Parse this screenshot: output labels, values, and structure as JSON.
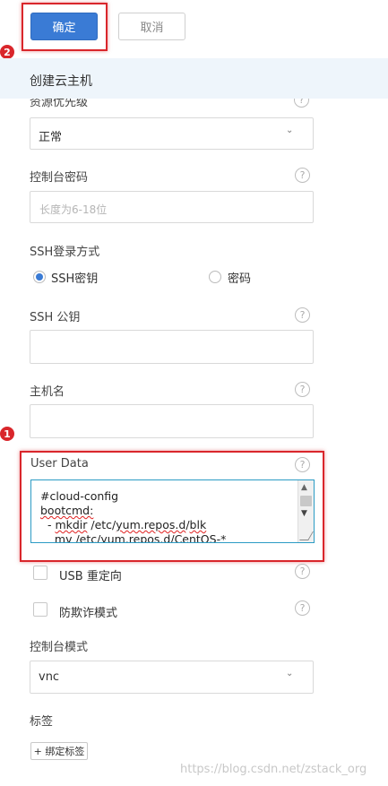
{
  "toolbar": {
    "confirm_label": "确定",
    "cancel_label": "取消"
  },
  "annotations": {
    "badge_1": "1",
    "badge_2": "2"
  },
  "header": {
    "title": "创建云主机"
  },
  "fields": {
    "resource_priority": {
      "label": "资源优先级",
      "value": "正常"
    },
    "console_password": {
      "label": "控制台密码",
      "placeholder": "长度为6-18位"
    },
    "ssh_login": {
      "label": "SSH登录方式",
      "option_key": "SSH密钥",
      "option_password": "密码",
      "selected": "SSH密钥"
    },
    "ssh_pubkey": {
      "label": "SSH 公钥",
      "value": ""
    },
    "hostname": {
      "label": "主机名",
      "value": ""
    },
    "user_data": {
      "label": "User Data",
      "line1": "#cloud-config",
      "line2": "bootcmd:",
      "line3_pre": "  - ",
      "line3_a": "mkdir",
      "line3_b": " /etc/",
      "line3_c": "yum.repos.d",
      "line3_d": "/",
      "line3_e": "blk",
      "line4": "    mv /etc/yum.repos.d/CentOS-*"
    },
    "usb_redirect": {
      "label": "USB 重定向",
      "checked": false
    },
    "anti_fraud": {
      "label": "防欺诈模式",
      "checked": false
    },
    "console_mode": {
      "label": "控制台模式",
      "value": "vnc"
    },
    "tags": {
      "label": "标签",
      "add_button": "+ 绑定标签"
    }
  },
  "icons": {
    "help": "?",
    "chevron_down": "⌄",
    "scroll_up": "▲",
    "scroll_down": "▼"
  },
  "watermark": "https://blog.csdn.net/zstack_org",
  "colors": {
    "primary": "#3a7bd5",
    "annotation_red": "#d9262b",
    "header_band": "#eef5fb"
  }
}
